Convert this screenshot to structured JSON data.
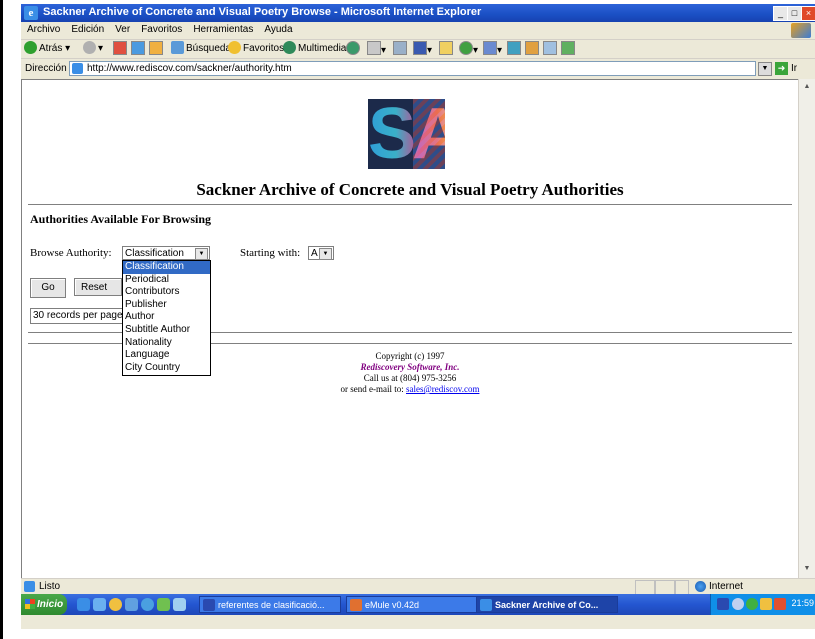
{
  "window": {
    "title": "Sackner Archive of Concrete and Visual Poetry Browse - Microsoft Internet Explorer",
    "buttons": [
      "_",
      "□",
      "×"
    ]
  },
  "menubar": [
    "Archivo",
    "Edición",
    "Ver",
    "Favoritos",
    "Herramientas",
    "Ayuda"
  ],
  "toolbar": {
    "back": "Atrás",
    "search": "Búsqueda",
    "favorites": "Favoritos",
    "multimedia": "Multimedia"
  },
  "address": {
    "label": "Dirección",
    "url": "http://www.rediscov.com/sackner/authority.htm",
    "go_label": "Ir"
  },
  "page": {
    "logo_text": "SA",
    "heading": "Sackner Archive of Concrete and Visual Poetry Authorities",
    "section_title": "Authorities Available For Browsing",
    "browse_label": "Browse Authority:",
    "browse_selected": "Classification",
    "browse_options": [
      "Classification",
      "Periodical",
      "Contributors",
      "Publisher",
      "Author",
      "Subtitle Author",
      "Nationality",
      "Language",
      "City Country"
    ],
    "starting_label": "Starting with:",
    "starting_selected": "A",
    "go_button": "Go",
    "reset_button": "Reset",
    "records_value": "30 records per page",
    "footer": {
      "copyright": "Copyright (c) 1997",
      "company": "Rediscovery Software, Inc.",
      "call": "Call us at (804) 975-3256",
      "email_prefix": "or send e-mail to:",
      "email": "sales@rediscov.com"
    }
  },
  "statusbar": {
    "status": "Listo",
    "zone": "Internet"
  },
  "taskbar": {
    "start": "Inicio",
    "tasks": [
      "referentes de clasificació...",
      "eMule v0.42d",
      "Sackner Archive of Co..."
    ],
    "clock": "21:59"
  }
}
